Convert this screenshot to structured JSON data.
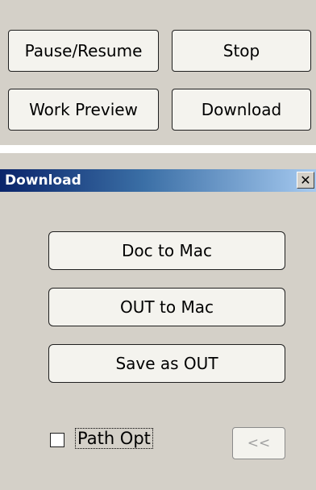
{
  "top_panel": {
    "pause_resume_label": "Pause/Resume",
    "stop_label": "Stop",
    "work_preview_label": "Work Preview",
    "download_label": "Download"
  },
  "dialog": {
    "title": "Download",
    "close_glyph": "✕",
    "doc_to_mac_label": "Doc to Mac",
    "out_to_mac_label": "OUT to Mac",
    "save_as_out_label": "Save as OUT",
    "path_opt_label": "Path Opt",
    "path_opt_checked": false,
    "collapse_label": "<<"
  },
  "colors": {
    "panel_bg": "#d4d0c8",
    "button_bg": "#f4f3ee",
    "title_gradient_start": "#0a246a",
    "title_gradient_end": "#a6caf0"
  }
}
